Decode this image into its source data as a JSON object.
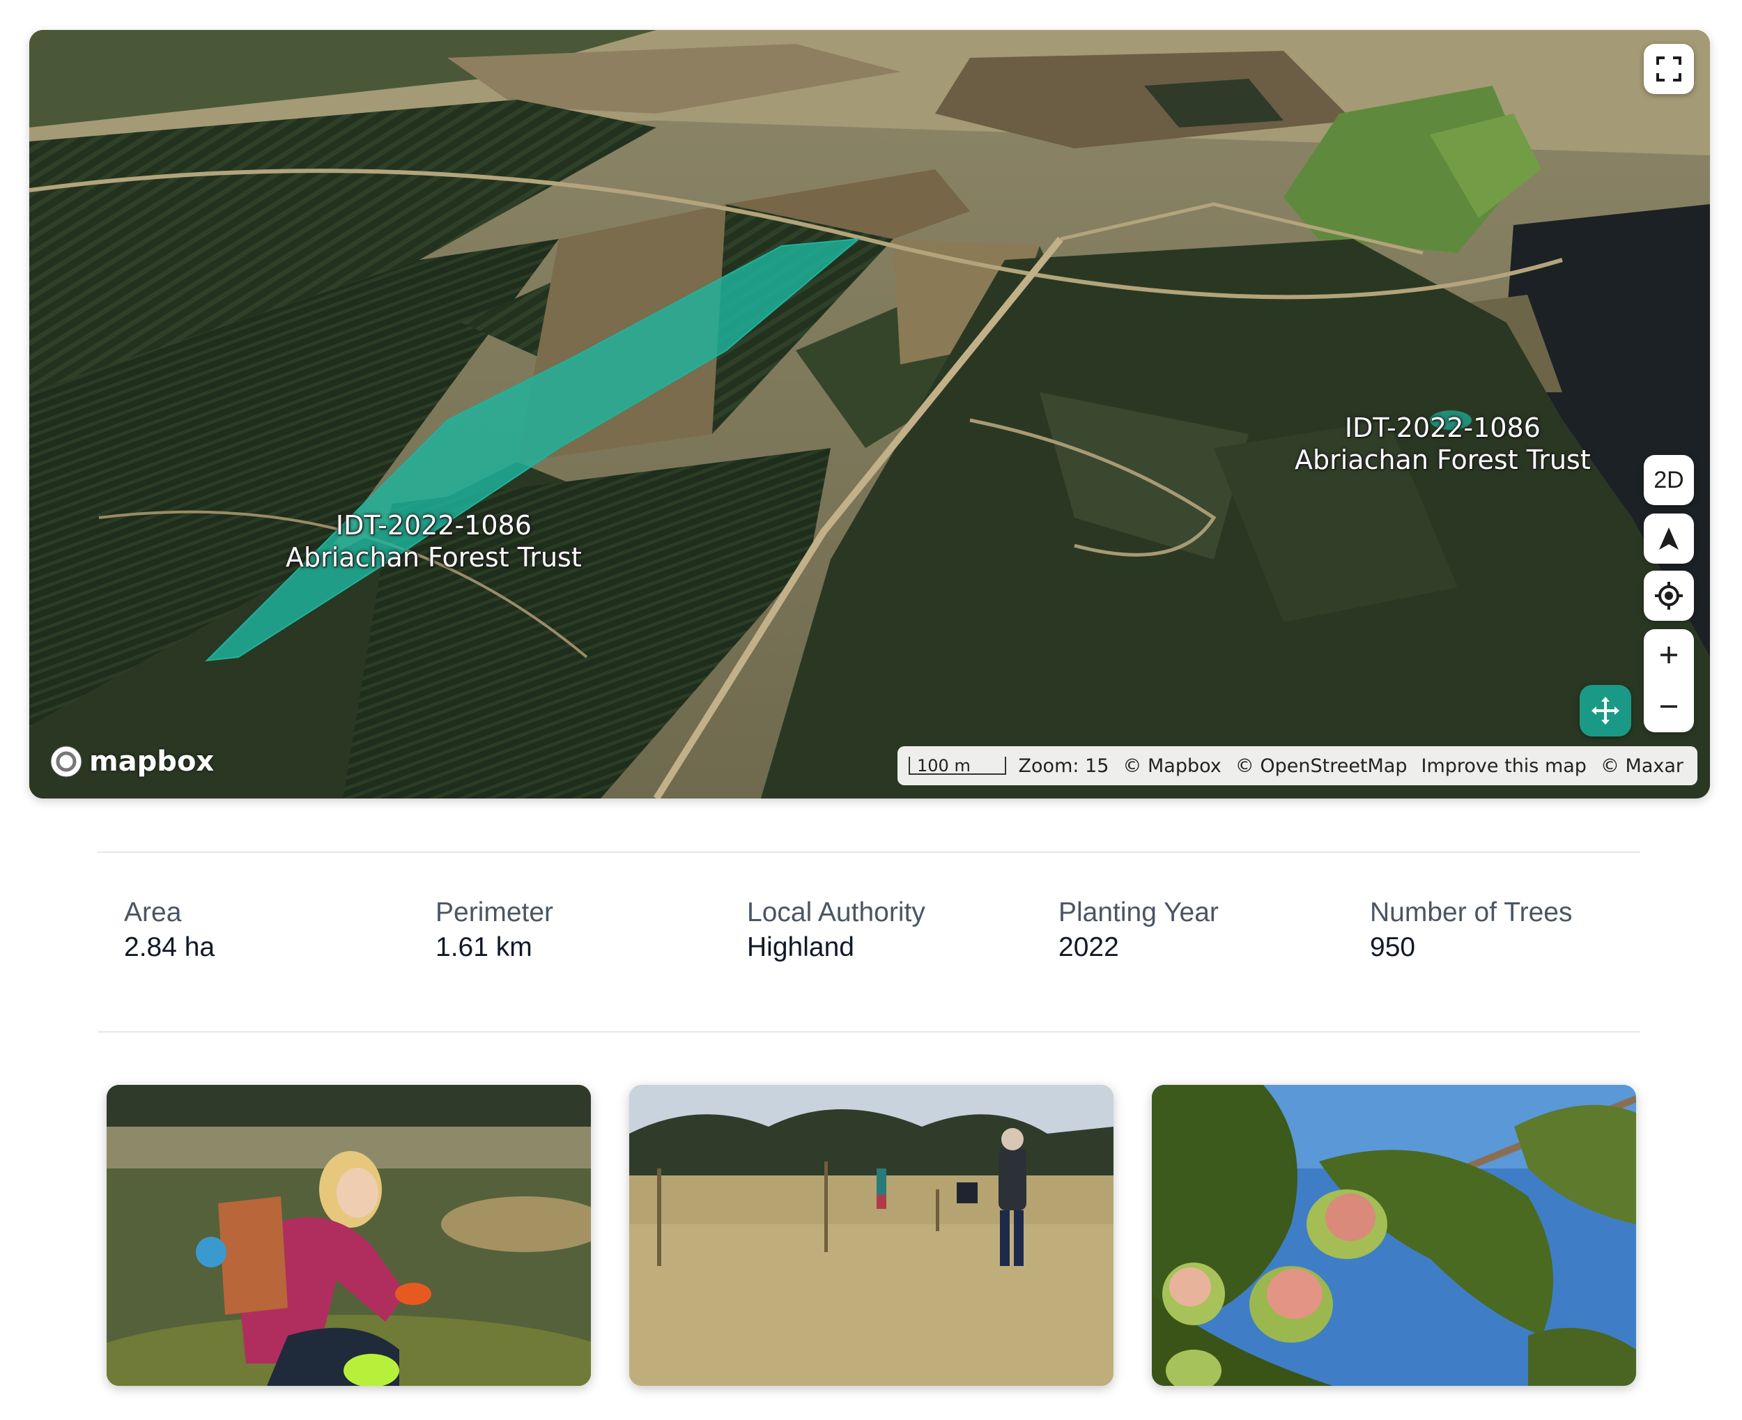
{
  "map": {
    "polygons": [
      {
        "id": "IDT-2022-1086",
        "owner": "Abriachan Forest Trust"
      },
      {
        "id": "IDT-2022-1086",
        "owner": "Abriachan Forest Trust"
      }
    ],
    "polygon_color": "#1fb39c",
    "controls": {
      "view_toggle_label": "2D",
      "fullscreen_icon": "fullscreen-icon",
      "compass_icon": "navigation-arrow-icon",
      "locate_icon": "crosshair-icon",
      "zoom_in_icon": "plus-icon",
      "zoom_out_icon": "minus-icon",
      "recenter_icon": "move-arrows-icon"
    },
    "logo_text": "mapbox",
    "scale_label": "100 m",
    "zoom_text": "Zoom: 15",
    "attributions": [
      "© Mapbox",
      "© OpenStreetMap",
      "Improve this map",
      "© Maxar"
    ]
  },
  "stats": [
    {
      "label": "Area",
      "value": "2.84 ha"
    },
    {
      "label": "Perimeter",
      "value": "1.61 km"
    },
    {
      "label": "Local Authority",
      "value": "Highland"
    },
    {
      "label": "Planting Year",
      "value": "2022"
    },
    {
      "label": "Number of Trees",
      "value": "950"
    }
  ],
  "photos": [
    {
      "subject": "volunteer-planting-photo"
    },
    {
      "subject": "planting-site-field-photo"
    },
    {
      "subject": "hazelnut-branch-photo"
    }
  ]
}
